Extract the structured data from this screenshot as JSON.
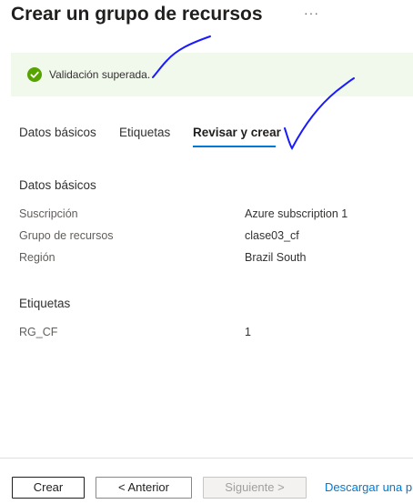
{
  "header": {
    "title": "Crear un grupo de recursos",
    "more_label": "···"
  },
  "banner": {
    "message": "Validación superada.",
    "status_color": "#57a300",
    "icon": "check-circle-icon"
  },
  "tabs": [
    {
      "label": "Datos básicos",
      "active": false
    },
    {
      "label": "Etiquetas",
      "active": false
    },
    {
      "label": "Revisar y crear",
      "active": true
    }
  ],
  "basics": {
    "section_title": "Datos básicos",
    "rows": [
      {
        "label": "Suscripción",
        "value": "Azure subscription 1"
      },
      {
        "label": "Grupo de recursos",
        "value": "clase03_cf"
      },
      {
        "label": "Región",
        "value": "Brazil South"
      }
    ]
  },
  "tags": {
    "section_title": "Etiquetas",
    "rows": [
      {
        "label": "RG_CF",
        "value": "1"
      }
    ]
  },
  "footer": {
    "create_label": "Crear",
    "previous_label": "< Anterior",
    "next_label": "Siguiente >",
    "download_link": "Descargar una p"
  },
  "colors": {
    "accent": "#0078d4",
    "annotation_ink": "#1a1aff"
  }
}
